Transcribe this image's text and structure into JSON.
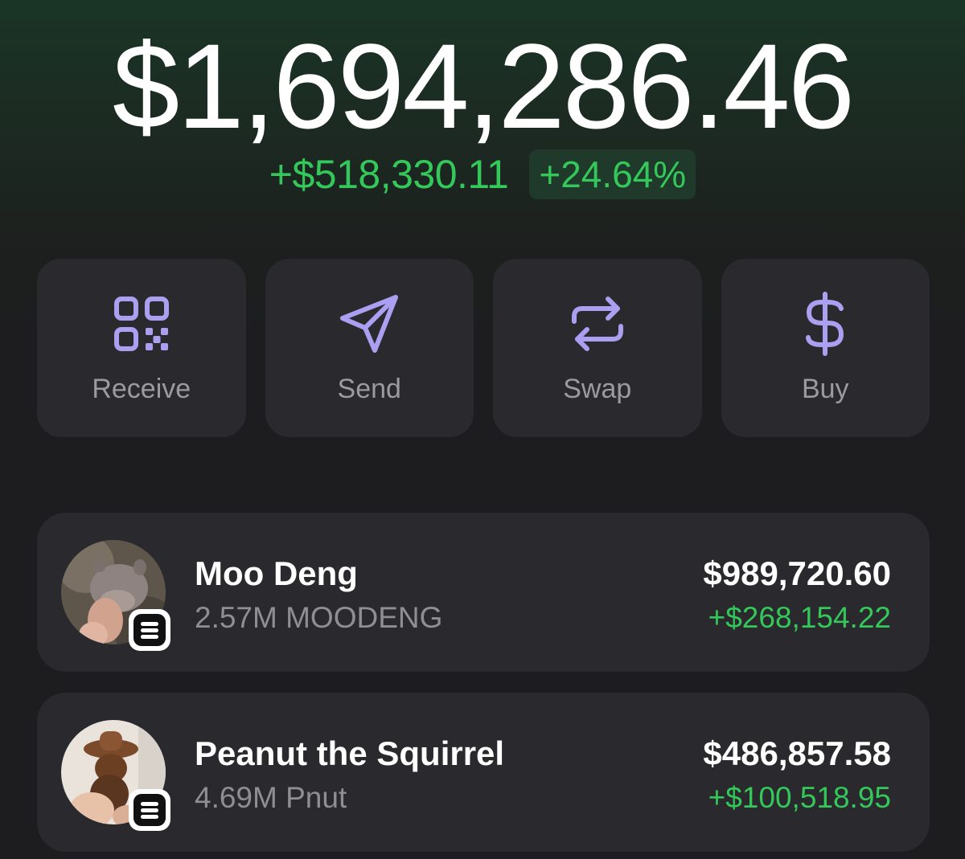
{
  "portfolio": {
    "balance": "$1,694,286.46",
    "change_amount": "+$518,330.11",
    "change_percent": "+24.64%"
  },
  "actions": [
    {
      "label": "Receive",
      "icon": "qr-code-icon"
    },
    {
      "label": "Send",
      "icon": "send-icon"
    },
    {
      "label": "Swap",
      "icon": "swap-icon"
    },
    {
      "label": "Buy",
      "icon": "dollar-icon"
    }
  ],
  "tokens": [
    {
      "name": "Moo Deng",
      "amount": "2.57M MOODENG",
      "value": "$989,720.60",
      "change": "+$268,154.22",
      "avatar": "moo-deng-avatar",
      "chain_badge": "solana-badge-icon"
    },
    {
      "name": "Peanut the Squirrel",
      "amount": "4.69M Pnut",
      "value": "$486,857.58",
      "change": "+$100,518.95",
      "avatar": "peanut-squirrel-avatar",
      "chain_badge": "solana-badge-icon"
    }
  ],
  "colors": {
    "background": "#1d1d1f",
    "card": "#2a2a2e",
    "positive": "#34c759",
    "accent": "#ab9ff2"
  }
}
